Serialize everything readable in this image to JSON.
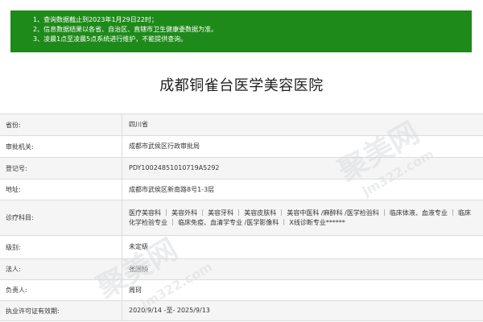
{
  "notice": {
    "lines": [
      "1、查询数据截止到2023年1月29日22时；",
      "2、信息数据结果以各省、自治区、直辖市卫生健康委数据为准。",
      "3、凌晨1点至凌晨5点系统进行维护，不能提供查询。"
    ]
  },
  "page_title": "成都铜雀台医学美容医院",
  "info": {
    "province": {
      "label": "省份:",
      "value": "四川省"
    },
    "approval_authority": {
      "label": "审批机关:",
      "value": "成都市武侯区行政审批局"
    },
    "registration_no": {
      "label": "登记号:",
      "value": "PDY10024851010719A5292"
    },
    "address": {
      "label": "地址:",
      "value": "成都市武侯区新南路8号1-3层"
    },
    "departments": {
      "label": "诊疗科目:",
      "value": "医疗美容科 ｜ 美容外科 ｜ 美容牙科 ｜ 美容皮肤科 ｜ 美容中医科 /麻醉科 /医学检验科 ｜ 临床体液、血液专业 ｜ 临床化学检验专业 ｜ 临床免疫、血清学专业 /医学影像科 ｜ X线诊断专业******"
    },
    "level": {
      "label": "级别:",
      "value": "未定级"
    },
    "legal_person": {
      "label": "法人:",
      "value": "张国桥"
    },
    "person_in_charge": {
      "label": "负责人:",
      "value": "周珂"
    },
    "license_validity": {
      "label": "执业许可证有效期:",
      "value": "2020/9/14 -至- 2025/9/13"
    }
  },
  "watermark": {
    "brand": "聚美网",
    "domain": "jm322.com"
  }
}
